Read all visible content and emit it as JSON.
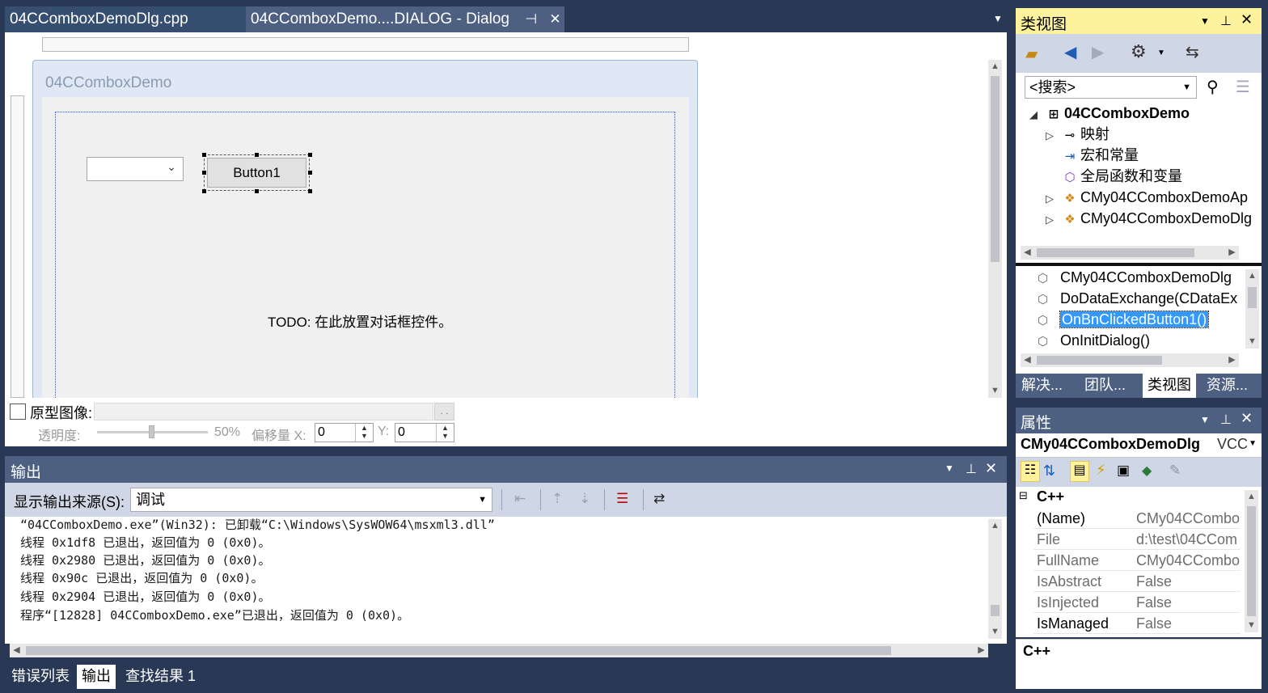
{
  "tabs": [
    {
      "label": "04CComboxDemoDlg.cpp",
      "active": false
    },
    {
      "label": "04CComboxDemo....DIALOG - Dialog",
      "active": true
    }
  ],
  "dialog": {
    "title": "04CComboxDemo",
    "button_label": "Button1",
    "todo_label": "TODO:",
    "todo_text": "在此放置对话框控件。"
  },
  "proto": {
    "label": "原型图像:",
    "transparency_label": "透明度:",
    "transparency_value": "50%",
    "offset_x_label": "偏移量 X:",
    "offset_x_value": "0",
    "offset_y_label": "Y:",
    "offset_y_value": "0",
    "browse_label": ". ."
  },
  "output": {
    "title": "输出",
    "source_label": "显示输出来源(S):",
    "source_value": "调试",
    "lines": [
      "“04CComboxDemo.exe”(Win32): 已卸载“C:\\Windows\\SysWOW64\\msxml3.dll”",
      "线程 0x1df8 已退出，返回值为 0 (0x0)。",
      "线程 0x2980 已退出，返回值为 0 (0x0)。",
      "线程 0x90c 已退出，返回值为 0 (0x0)。",
      "线程 0x2904 已退出，返回值为 0 (0x0)。",
      "程序“[12828] 04CComboxDemo.exe”已退出，返回值为 0 (0x0)。"
    ]
  },
  "bottom_tabs": [
    "错误列表",
    "输出",
    "查找结果 1"
  ],
  "class_view": {
    "title": "类视图",
    "search_placeholder": "<搜索>",
    "tree": [
      {
        "label": "04CComboxDemo"
      },
      {
        "label": "映射"
      },
      {
        "label": "宏和常量"
      },
      {
        "label": "全局函数和变量"
      },
      {
        "label": "CMy04CComboxDemoAp"
      },
      {
        "label": "CMy04CComboxDemoDlg"
      }
    ],
    "members": [
      "CMy04CComboxDemoDlg",
      "DoDataExchange(CDataEx",
      "OnBnClickedButton1()",
      "OnInitDialog()"
    ],
    "tabs": [
      "解决...",
      "团队...",
      "类视图",
      "资源..."
    ]
  },
  "properties": {
    "title": "属性",
    "object": "CMy04CComboxDemoDlg",
    "object_type": "VCC",
    "category": "C++",
    "rows": [
      {
        "name": "(Name)",
        "value": "CMy04CCombo"
      },
      {
        "name": "File",
        "value": "d:\\test\\04CCom"
      },
      {
        "name": "FullName",
        "value": "CMy04CCombo"
      },
      {
        "name": "IsAbstract",
        "value": "False"
      },
      {
        "name": "IsInjected",
        "value": "False"
      },
      {
        "name": "IsManaged",
        "value": "False"
      }
    ],
    "description": "C++"
  },
  "colors": {
    "chrome": "#293955",
    "tab_active": "#4d6082",
    "panel_active_header": "#fff29d",
    "selection": "#3399ff"
  }
}
